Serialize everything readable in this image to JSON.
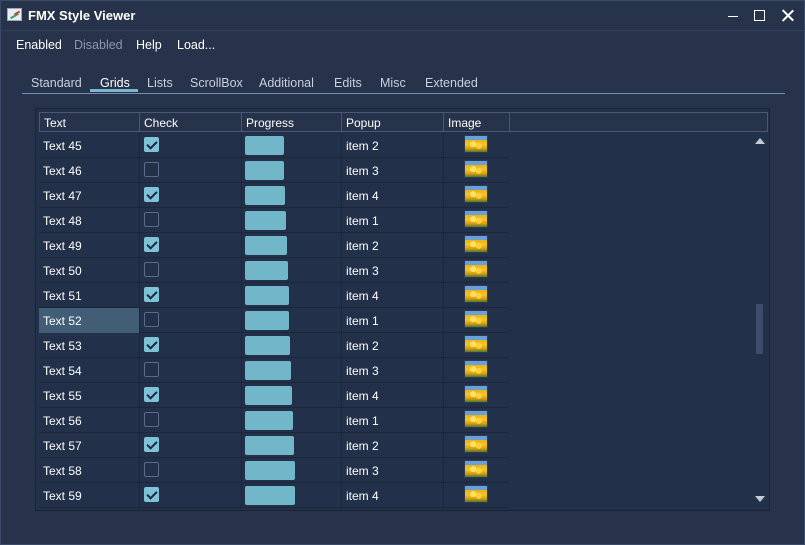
{
  "window": {
    "title": "FMX Style Viewer"
  },
  "menubar": {
    "items": [
      {
        "label": "Enabled",
        "disabled": false
      },
      {
        "label": "Disabled",
        "disabled": true
      },
      {
        "label": "Help",
        "disabled": false
      },
      {
        "label": "Load...",
        "disabled": false
      }
    ]
  },
  "tabs": [
    {
      "label": "Standard",
      "active": false
    },
    {
      "label": "Grids",
      "active": true
    },
    {
      "label": "Lists",
      "active": false
    },
    {
      "label": "ScrollBox",
      "active": false
    },
    {
      "label": "Additional",
      "active": false
    },
    {
      "label": "Edits",
      "active": false
    },
    {
      "label": "Misc",
      "active": false
    },
    {
      "label": "Extended",
      "active": false
    }
  ],
  "grid": {
    "columns": [
      "Text",
      "Check",
      "Progress",
      "Popup",
      "Image",
      ""
    ],
    "selected_row_text": "Text 52",
    "rows": [
      {
        "text": "Text 45",
        "checked": true,
        "progress": 45,
        "popup": "item 2"
      },
      {
        "text": "Text 46",
        "checked": false,
        "progress": 46,
        "popup": "item 3"
      },
      {
        "text": "Text 47",
        "checked": true,
        "progress": 47,
        "popup": "item 4"
      },
      {
        "text": "Text 48",
        "checked": false,
        "progress": 48,
        "popup": "item 1"
      },
      {
        "text": "Text 49",
        "checked": true,
        "progress": 49,
        "popup": "item 2"
      },
      {
        "text": "Text 50",
        "checked": false,
        "progress": 50,
        "popup": "item 3"
      },
      {
        "text": "Text 51",
        "checked": true,
        "progress": 51,
        "popup": "item 4"
      },
      {
        "text": "Text 52",
        "checked": false,
        "progress": 52,
        "popup": "item 1"
      },
      {
        "text": "Text 53",
        "checked": true,
        "progress": 53,
        "popup": "item 2"
      },
      {
        "text": "Text 54",
        "checked": false,
        "progress": 54,
        "popup": "item 3"
      },
      {
        "text": "Text 55",
        "checked": true,
        "progress": 55,
        "popup": "item 4"
      },
      {
        "text": "Text 56",
        "checked": false,
        "progress": 56,
        "popup": "item 1"
      },
      {
        "text": "Text 57",
        "checked": true,
        "progress": 57,
        "popup": "item 2"
      },
      {
        "text": "Text 58",
        "checked": false,
        "progress": 58,
        "popup": "item 3"
      },
      {
        "text": "Text 59",
        "checked": true,
        "progress": 59,
        "popup": "item 4"
      }
    ]
  },
  "icons": {
    "app": "app-icon",
    "minimize": "minimize-icon",
    "maximize": "maximize-icon",
    "close": "close-icon",
    "row_image": "flowers-thumbnail-icon"
  },
  "colors": {
    "background": "#27324b",
    "accent": "#7fc3d8",
    "progress": "#72b6ca",
    "selected_cell": "#415e76"
  }
}
